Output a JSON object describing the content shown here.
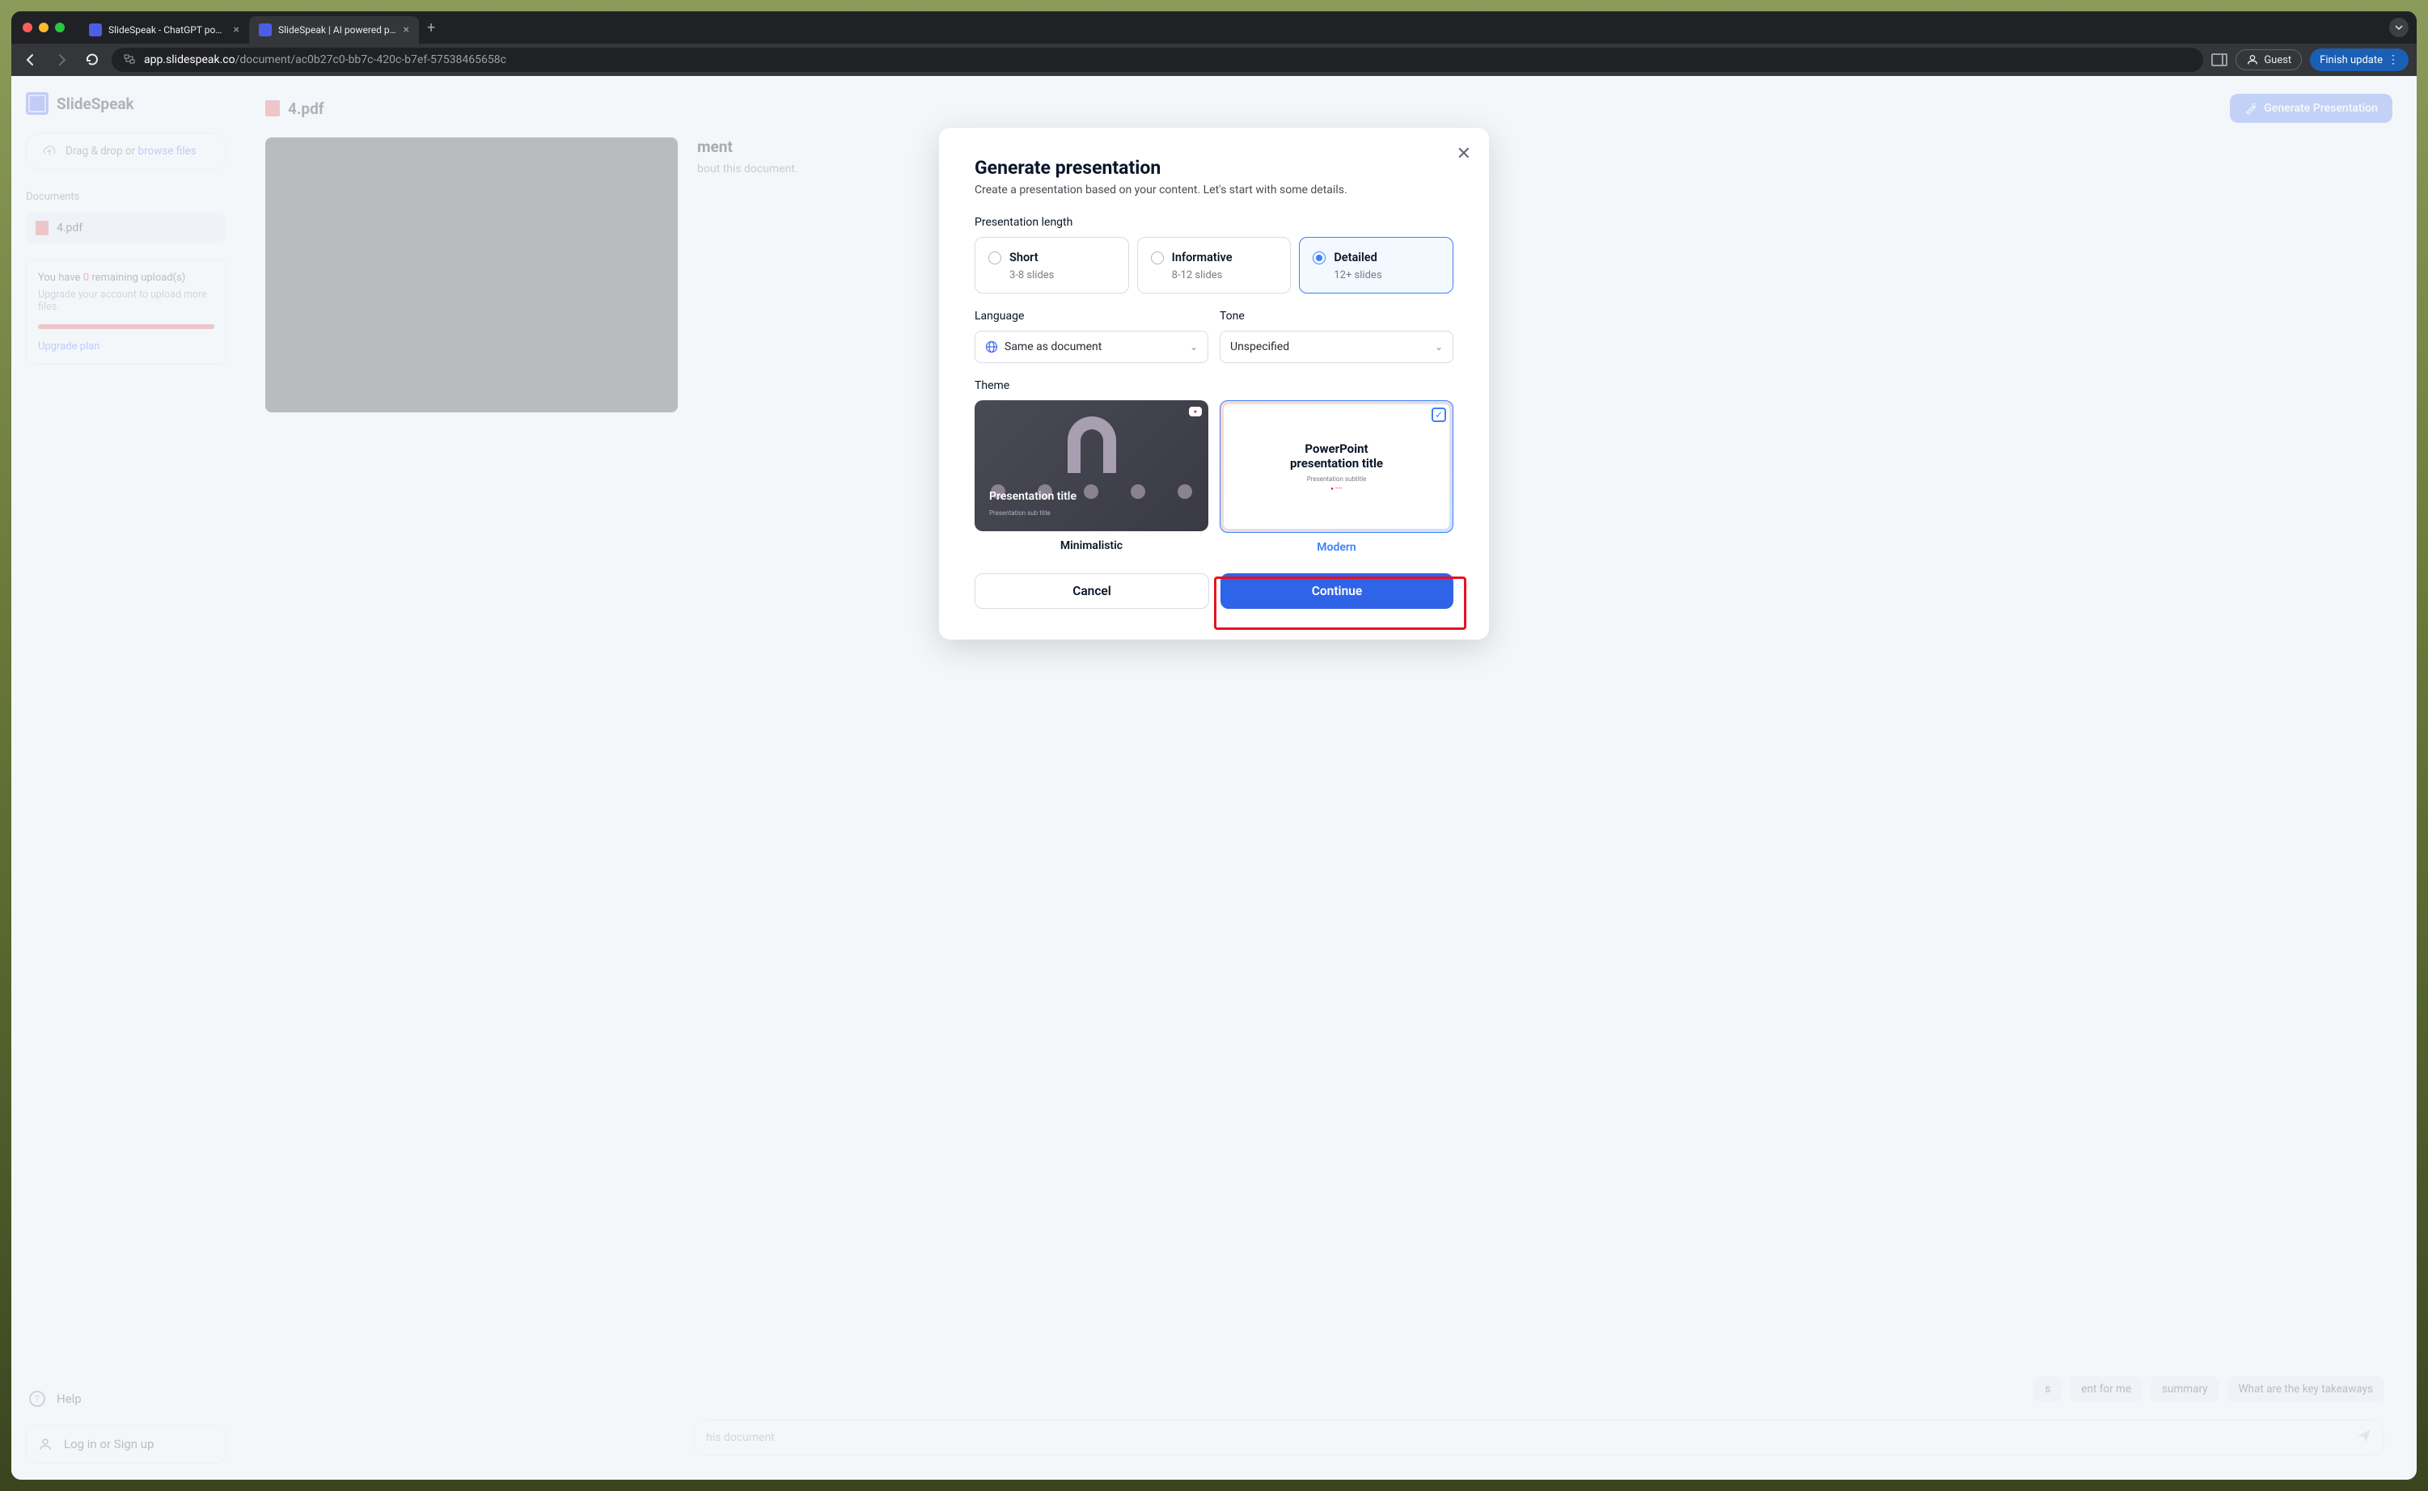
{
  "browser": {
    "tabs": [
      {
        "title": "SlideSpeak - ChatGPT powe…"
      },
      {
        "title": "SlideSpeak | AI powered pres…"
      }
    ],
    "url_domain": "app.slidespeak.co",
    "url_path": "/document/ac0b27c0-bb7c-420c-b7ef-57538465658c",
    "guest_label": "Guest",
    "finish_label": "Finish update"
  },
  "sidebar": {
    "brand": "SlideSpeak",
    "upload_prefix": "Drag & drop or ",
    "upload_link": "browse files",
    "documents_label": "Documents",
    "doc_name": "4.pdf",
    "upgrade": {
      "line1_prefix": "You have ",
      "line1_count": "0",
      "line1_suffix": " remaining upload(s)",
      "line2": "Upgrade your account to upload more files.",
      "link": "Upgrade plan"
    },
    "help": "Help",
    "login": "Log in or Sign up"
  },
  "main": {
    "file_name": "4.pdf",
    "generate_btn": "Generate Presentation",
    "chat_title_suffix": "ment",
    "chat_sub_suffix": "bout this document.",
    "suggestions": {
      "s1_suffix": "s",
      "s2_suffix": "ent for me",
      "s3_suffix": " summary",
      "s4": "What are the key takeaways"
    },
    "input_placeholder_suffix": "his document"
  },
  "modal": {
    "title": "Generate presentation",
    "subtitle": "Create a presentation based on your content. Let's start with some details.",
    "length_label": "Presentation length",
    "lengths": [
      {
        "title": "Short",
        "sub": "3-8 slides"
      },
      {
        "title": "Informative",
        "sub": "8-12 slides"
      },
      {
        "title": "Detailed",
        "sub": "12+ slides"
      }
    ],
    "language_label": "Language",
    "language_value": "Same as document",
    "tone_label": "Tone",
    "tone_value": "Unspecified",
    "theme_label": "Theme",
    "themes": {
      "minimalistic": {
        "label": "Minimalistic",
        "preview_title": "Presentation title",
        "preview_sub": "Presentation sub title"
      },
      "modern": {
        "label": "Modern",
        "preview_title1": "PowerPoint",
        "preview_title2": "presentation title",
        "preview_sub": "Presentation subtitle"
      }
    },
    "cancel": "Cancel",
    "continue": "Continue"
  }
}
